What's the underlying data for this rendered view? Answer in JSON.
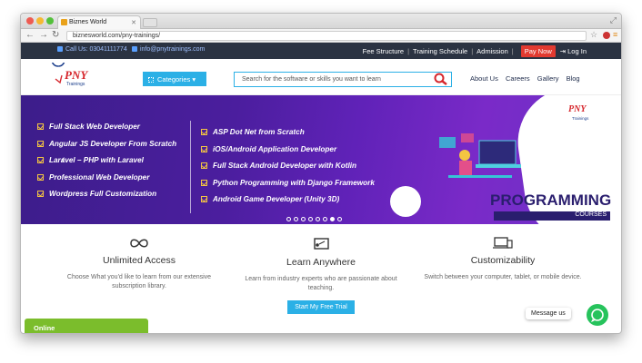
{
  "browser": {
    "tab_title": "Biznes World",
    "url": "biznesworld.com/pny-trainings/"
  },
  "topbar": {
    "phone": "Call Us: 03041111774",
    "email": "info@pnytrainings.com",
    "links": [
      "Fee Structure",
      "Training Schedule",
      "Admission"
    ],
    "pay_now": "Pay Now",
    "login": "Log In"
  },
  "header": {
    "logo_text": "PNY",
    "logo_sub": "Trainings",
    "categories_label": "Categories",
    "search_placeholder": "Search for the software or skills you want to learn",
    "nav": [
      "About Us",
      "Careers",
      "Gallery",
      "Blog"
    ]
  },
  "hero": {
    "left_items": [
      "Full Stack Web Developer",
      "Angular JS Developer From Scratch",
      "Laravel – PHP with Laravel",
      "Professional Web Developer",
      "Wordpress Full Customization"
    ],
    "right_items": [
      "ASP Dot Net from Scratch",
      "iOS/Android Application Developer",
      "Full Stack Android Developer with Kotlin",
      "Python Programming with Django Framework",
      "Android Game Developer (Unity 3D)"
    ],
    "banner_title": "PROGRAMMING",
    "banner_sub": "COURSES",
    "logo_text": "PNY",
    "logo_sub": "Trainings",
    "slide_count": 8,
    "active_slide": 7,
    "accent": "#f4c542"
  },
  "features": [
    {
      "icon": "infinity-icon",
      "title": "Unlimited Access",
      "desc": "Choose What you'd like to learn from our extensive subscription library."
    },
    {
      "icon": "teacher-board-icon",
      "title": "Learn Anywhere",
      "desc": "Learn from industry experts who are passionate about teaching.",
      "button": "Start My Free Trial"
    },
    {
      "icon": "devices-icon",
      "title": "Customizability",
      "desc": "Switch between your computer, tablet, or mobile device."
    }
  ],
  "widgets": {
    "online": "Online",
    "message_us": "Message us"
  }
}
